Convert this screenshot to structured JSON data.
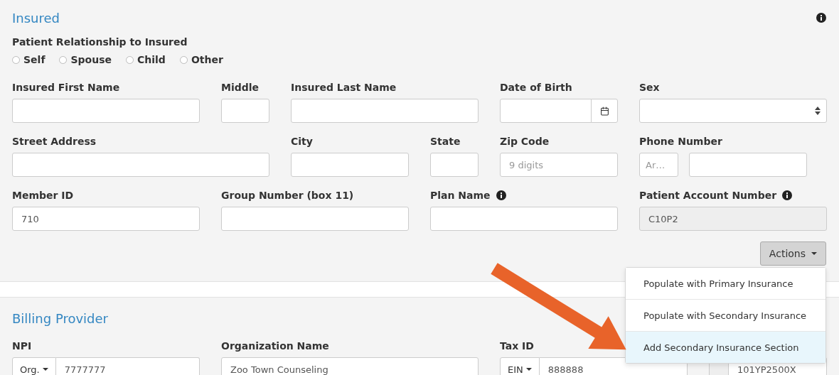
{
  "insured": {
    "title": "Insured",
    "info": true,
    "relationship": {
      "label": "Patient Relationship to Insured",
      "options": [
        {
          "label": "Self",
          "selected": false
        },
        {
          "label": "Spouse",
          "selected": false
        },
        {
          "label": "Child",
          "selected": false
        },
        {
          "label": "Other",
          "selected": false
        }
      ]
    },
    "fields": [
      {
        "label": "Insured First Name",
        "kind": "text"
      },
      {
        "label": "Middle",
        "kind": "text"
      },
      {
        "label": "Insured Last Name",
        "kind": "text"
      },
      {
        "label": "Date of Birth",
        "kind": "date"
      },
      {
        "label": "Sex",
        "kind": "select"
      },
      {
        "label": "Street Address",
        "kind": "text"
      },
      {
        "label": "City",
        "kind": "text"
      },
      {
        "label": "State",
        "kind": "text"
      },
      {
        "label": "Zip Code",
        "kind": "text",
        "placeholder": "9 digits"
      },
      {
        "label": "Phone Number",
        "kind": "phone",
        "placeholder": "Ar…"
      },
      {
        "label": "Member ID",
        "kind": "text",
        "value": "710"
      },
      {
        "label": "Group Number (box 11)",
        "kind": "text"
      },
      {
        "label": "Plan Name",
        "kind": "text",
        "info": true
      },
      {
        "label": "Patient Account Number",
        "kind": "readonly",
        "value": "C10P2",
        "info": true
      }
    ],
    "actions": {
      "label": "Actions",
      "expanded": true,
      "items": [
        {
          "label": "Populate with Primary Insurance",
          "selected": false
        },
        {
          "label": "Populate with Secondary Insurance",
          "selected": false
        },
        {
          "label": "Add Secondary Insurance Section",
          "selected": true
        }
      ]
    }
  },
  "billing": {
    "title": "Billing Provider",
    "fields": [
      {
        "label": "NPI",
        "kind": "prefixed",
        "prefix": "Org.",
        "value": "7777777"
      },
      {
        "label": "Organization Name",
        "kind": "text",
        "value": "Zoo Town Counseling"
      },
      {
        "label": "Tax ID",
        "kind": "prefixed",
        "prefix": "EIN",
        "value": "888888"
      },
      {
        "kind": "addon",
        "value": "101YP2500X"
      }
    ]
  }
}
